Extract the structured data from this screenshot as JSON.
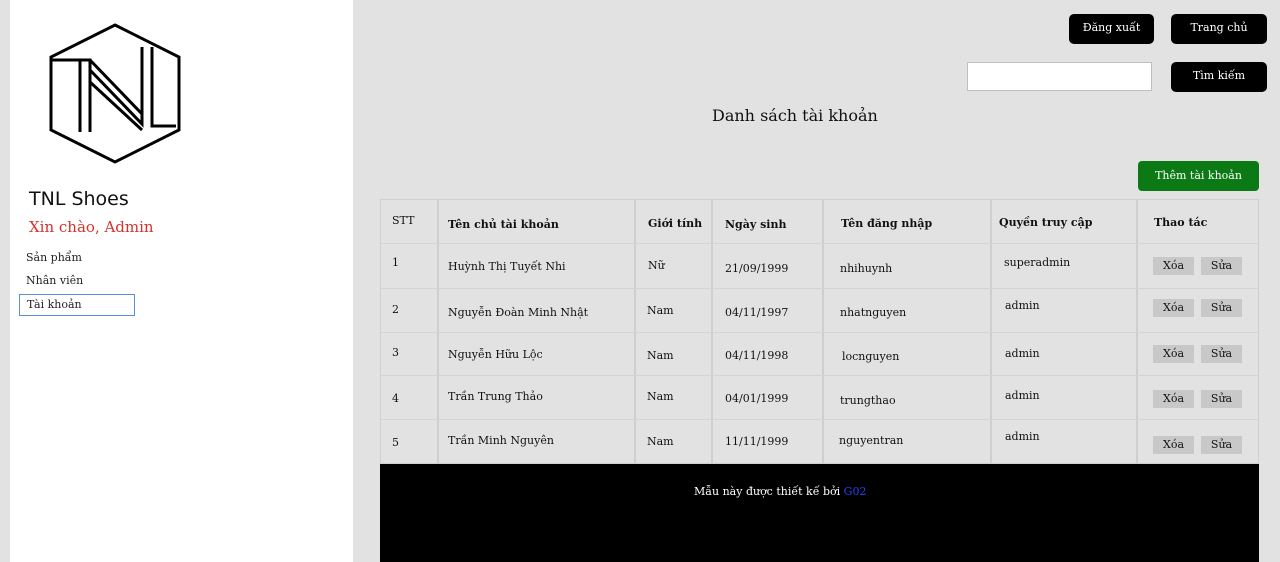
{
  "sidebar": {
    "brand": "TNL Shoes",
    "greeting": "Xin chào, Admin",
    "nav": [
      "Sản phẩm",
      "Nhân viên",
      "Tài khoản"
    ]
  },
  "header": {
    "logout_label": "Đăng xuất",
    "home_label": "Trang chủ",
    "search_value": "",
    "search_label": "Tìm kiếm"
  },
  "main": {
    "title": "Danh sách tài khoản",
    "add_label": "Thêm tài khoản",
    "table": {
      "headers": [
        "STT",
        "Tên chủ tài khoản",
        "Giới tính",
        "Ngày sinh",
        "Tên đăng nhập",
        "Quyền truy cập",
        "Thao tác"
      ],
      "rows": [
        {
          "stt": "1",
          "name": "Huỳnh Thị Tuyết Nhi",
          "gender": "Nữ",
          "dob": "21/09/1999",
          "username": "nhihuynh",
          "role": "superadmin"
        },
        {
          "stt": "2",
          "name": "Nguyễn Đoàn Minh Nhật",
          "gender": "Nam",
          "dob": "04/11/1997",
          "username": "nhatnguyen",
          "role": "admin"
        },
        {
          "stt": "3",
          "name": "Nguyễn Hữu Lộc",
          "gender": "Nam",
          "dob": "04/11/1998",
          "username": "locnguyen",
          "role": "admin"
        },
        {
          "stt": "4",
          "name": "Trần Trung Thảo",
          "gender": "Nam",
          "dob": "04/01/1999",
          "username": "trungthao",
          "role": "admin"
        },
        {
          "stt": "5",
          "name": "Trần Minh Nguyên",
          "gender": "Nam",
          "dob": "11/11/1999",
          "username": "nguyentran",
          "role": "admin"
        }
      ],
      "delete_label": "Xóa",
      "edit_label": "Sửa"
    }
  },
  "footer": {
    "text": "Mẫu này được thiết kế bởi",
    "link": "G02",
    "link_color": "#2a3cff"
  },
  "colors": {
    "greeting": "#d9302b",
    "add_button": "#0b7a14",
    "primary_button": "#000000"
  }
}
